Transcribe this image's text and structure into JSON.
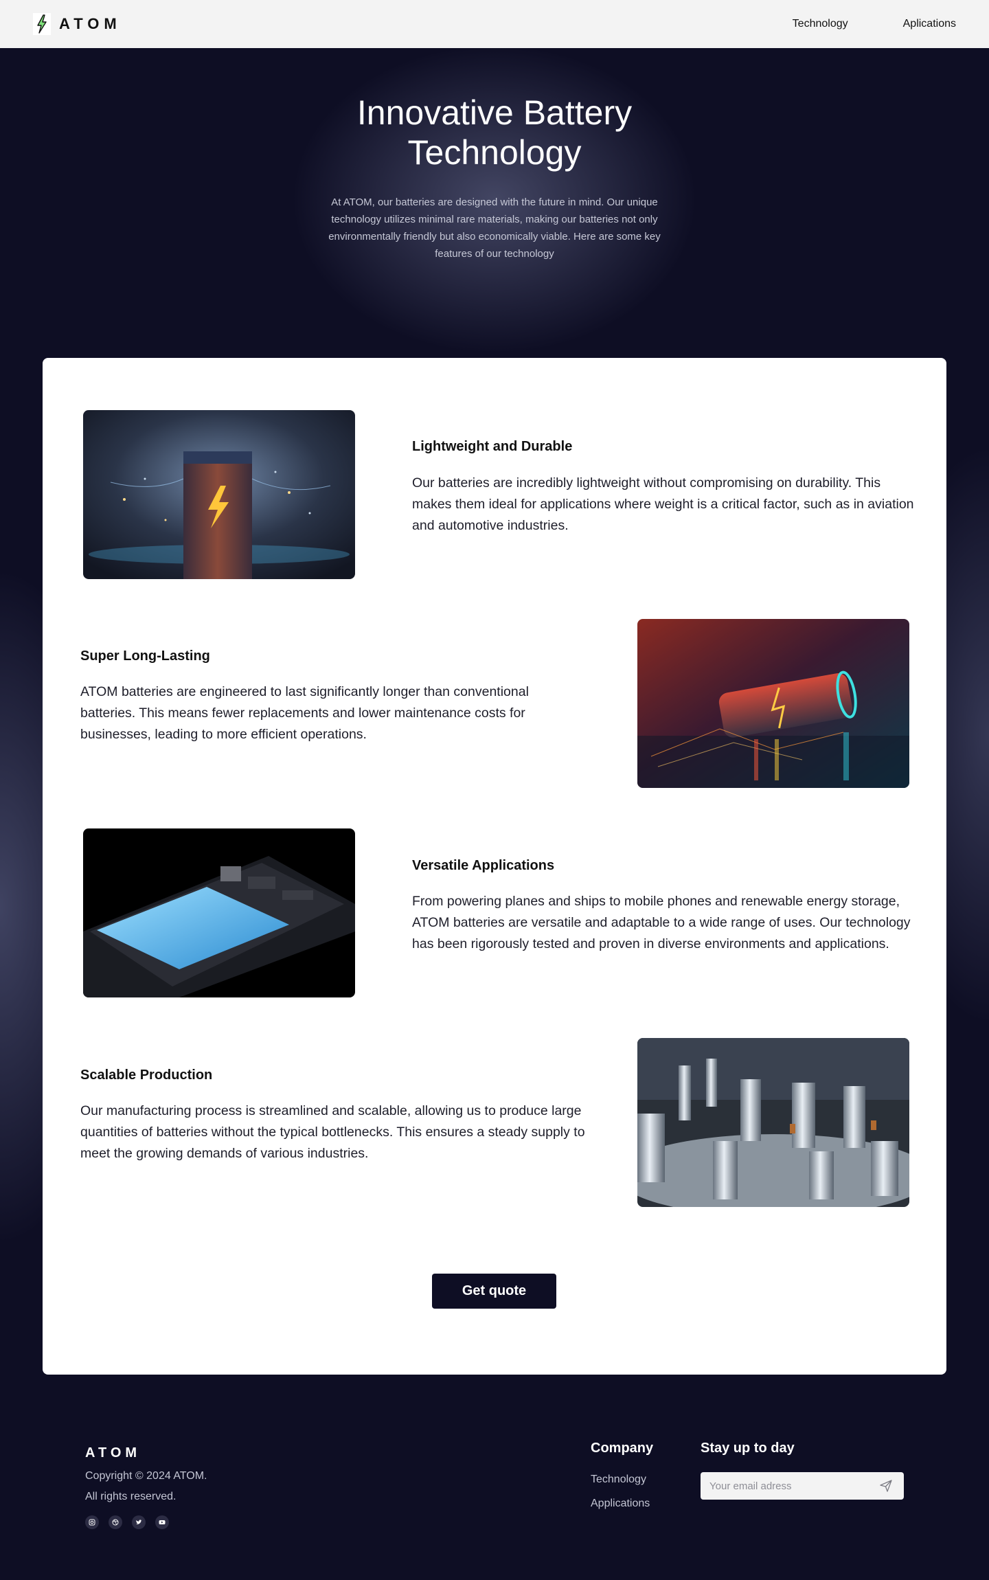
{
  "header": {
    "brand": "ATOM",
    "nav": [
      {
        "label": "Technology"
      },
      {
        "label": "Aplications"
      }
    ]
  },
  "hero": {
    "title": "Innovative Battery Technology",
    "description": "At ATOM, our batteries are designed with the future in mind. Our unique technology utilizes minimal rare materials, making our batteries not only environmentally friendly but also economically viable. Here are some key features of our technology"
  },
  "features": [
    {
      "title": "Lightweight and Durable",
      "text": "Our batteries are incredibly lightweight without compromising on durability. This makes them ideal for applications where weight is a critical factor, such as in aviation and automotive industries."
    },
    {
      "title": "Super Long-Lasting",
      "text": "ATOM batteries are engineered to last significantly longer than conventional batteries. This means fewer replacements and lower maintenance costs for businesses, leading to more efficient operations."
    },
    {
      "title": "Versatile Applications",
      "text": "From powering planes and ships to mobile phones and renewable energy storage, ATOM batteries are versatile and adaptable to a wide range of uses. Our technology has been rigorously tested and proven in diverse environments and applications."
    },
    {
      "title": "Scalable Production",
      "text": "Our manufacturing process is streamlined and scalable, allowing us to produce large quantities of batteries without the typical bottlenecks. This ensures a steady supply to meet the growing demands of various industries."
    }
  ],
  "cta": {
    "label": "Get quote"
  },
  "footer": {
    "brand": "ATOM",
    "copyright": "Copyright © 2024 ATOM.",
    "rights": "All rights reserved.",
    "socials": [
      "instagram-icon",
      "dribbble-icon",
      "twitter-icon",
      "youtube-icon"
    ],
    "company_title": "Company",
    "company_links": [
      {
        "label": "Technology"
      },
      {
        "label": "Applications"
      }
    ],
    "newsletter_title": "Stay up to day",
    "email_placeholder": "Your email adress"
  },
  "colors": {
    "navy": "#0e0e24",
    "header_bg": "#f3f3f3",
    "card_bg": "#ffffff"
  }
}
